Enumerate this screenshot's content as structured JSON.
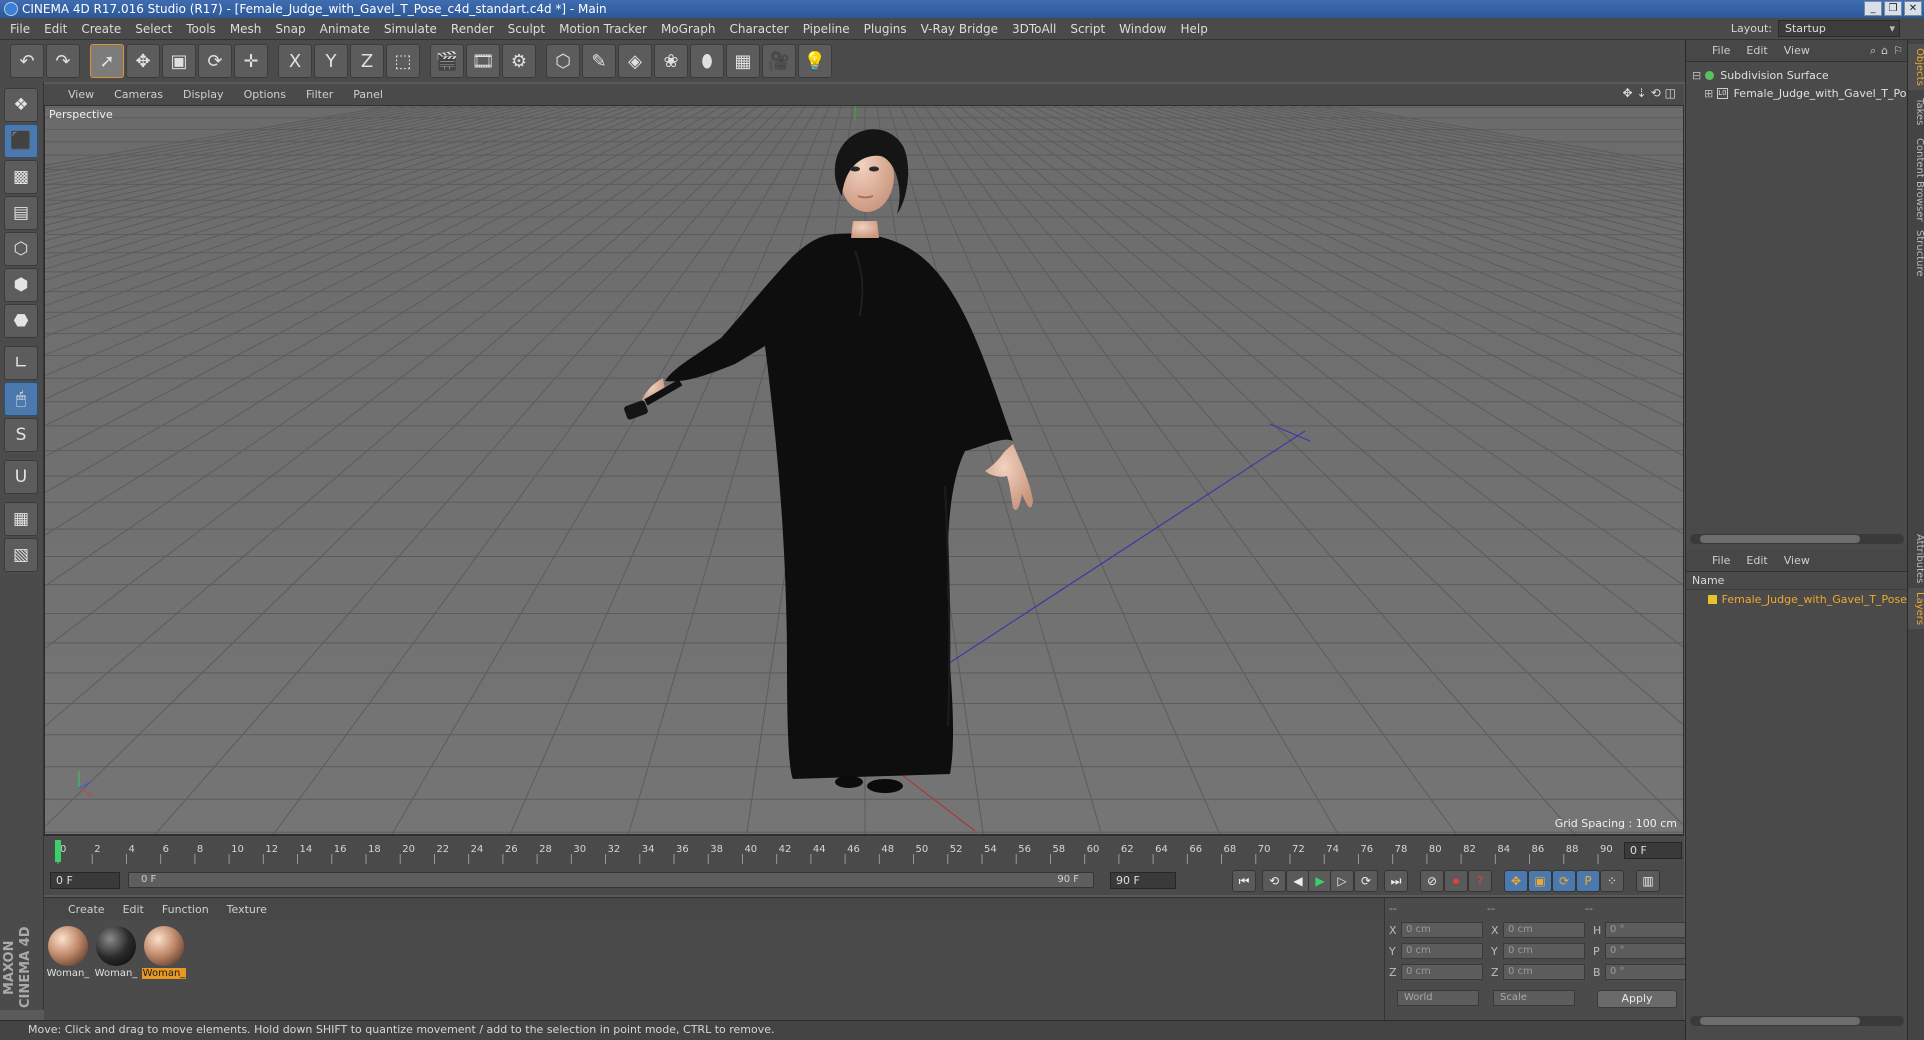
{
  "window": {
    "title": "CINEMA 4D R17.016 Studio (R17) - [Female_Judge_with_Gavel_T_Pose_c4d_standart.c4d *] - Main",
    "buttons": [
      "_",
      "❐",
      "✕"
    ]
  },
  "menu": {
    "items": [
      "File",
      "Edit",
      "Create",
      "Select",
      "Tools",
      "Mesh",
      "Snap",
      "Animate",
      "Simulate",
      "Render",
      "Sculpt",
      "Motion Tracker",
      "MoGraph",
      "Character",
      "Pipeline",
      "Plugins",
      "V-Ray Bridge",
      "3DToAll",
      "Script",
      "Window",
      "Help"
    ],
    "layout_label": "Layout:",
    "layout_value": "Startup"
  },
  "toolbar": {
    "icons": [
      "undo-icon",
      "redo-icon",
      "live-selection-icon",
      "move-icon",
      "scale-icon",
      "rotate-icon",
      "transform-icon",
      "x-axis-icon",
      "y-axis-icon",
      "z-axis-icon",
      "coordinate-system-icon",
      "render-view-icon",
      "render-picture-viewer-icon",
      "edit-render-settings-icon",
      "cube-icon",
      "pen-icon",
      "subdivision-icon",
      "array-icon",
      "deformer-icon",
      "floor-icon",
      "camera-icon",
      "light-icon"
    ],
    "glyphs": [
      "↶",
      "↷",
      "➚",
      "✥",
      "▣",
      "⟳",
      "✛",
      "X",
      "Y",
      "Z",
      "⬚",
      "🎬",
      "🎞",
      "⚙",
      "⬡",
      "✎",
      "◈",
      "❀",
      "⬮",
      "▦",
      "🎥",
      "💡"
    ]
  },
  "lefttools": {
    "icons": [
      "make-editable-icon",
      "model-mode-icon",
      "texture-mode-icon",
      "workplane-icon",
      "points-mode-icon",
      "edges-mode-icon",
      "polygons-mode-icon",
      "axis-mode-icon",
      "tweak-mode-icon",
      "solo-mode-icon",
      "magnet-icon",
      "snap-icon",
      "workplane-lock-icon"
    ],
    "glyphs": [
      "❖",
      "⬛",
      "▩",
      "▤",
      "⬡",
      "⬢",
      "⬣",
      "∟",
      "🖱",
      "S",
      "U",
      "▦",
      "▧"
    ]
  },
  "viewport": {
    "menu": [
      "View",
      "Cameras",
      "Display",
      "Options",
      "Filter",
      "Panel"
    ],
    "label": "Perspective",
    "grid_spacing": "Grid Spacing : 100 cm",
    "nav_glyphs": [
      "✥",
      "⇣",
      "⟲",
      "◫"
    ]
  },
  "timeline": {
    "ticks": [
      "0",
      "2",
      "4",
      "6",
      "8",
      "10",
      "12",
      "14",
      "16",
      "18",
      "20",
      "22",
      "24",
      "26",
      "28",
      "30",
      "32",
      "34",
      "36",
      "38",
      "40",
      "42",
      "44",
      "46",
      "48",
      "50",
      "52",
      "54",
      "56",
      "58",
      "60",
      "62",
      "64",
      "66",
      "68",
      "70",
      "72",
      "74",
      "76",
      "78",
      "80",
      "82",
      "84",
      "86",
      "88",
      "90"
    ],
    "current_frame": "0 F",
    "start_field": "0 F",
    "slider_start": "0 F",
    "slider_end": "90 F",
    "end_field": "90 F",
    "playback_glyphs": [
      "⏮",
      "⟲",
      "◀",
      "▶",
      "▷",
      "⟳",
      "⏭",
      "⊘",
      "⏺",
      "?",
      "✥",
      "▣",
      "⟳",
      "P",
      "⁘",
      "▥"
    ]
  },
  "materials": {
    "menu": [
      "Create",
      "Edit",
      "Function",
      "Texture"
    ],
    "items": [
      {
        "name": "Woman_",
        "selected": false,
        "dark": false
      },
      {
        "name": "Woman_",
        "selected": false,
        "dark": true
      },
      {
        "name": "Woman_",
        "selected": true,
        "dark": false
      }
    ],
    "brand": "MAXON CINEMA 4D"
  },
  "coordinates": {
    "header": [
      "--",
      "--",
      "--"
    ],
    "rows": [
      {
        "a": "X",
        "v1": "0 cm",
        "b": "X",
        "v2": "0 cm",
        "c": "H",
        "v3": "0 °"
      },
      {
        "a": "Y",
        "v1": "0 cm",
        "b": "Y",
        "v2": "0 cm",
        "c": "P",
        "v3": "0 °"
      },
      {
        "a": "Z",
        "v1": "0 cm",
        "b": "Z",
        "v2": "0 cm",
        "c": "B",
        "v3": "0 °"
      }
    ],
    "mode1": "World",
    "mode2": "Scale",
    "apply": "Apply"
  },
  "status": "Move: Click and drag to move elements. Hold down SHIFT to quantize movement / add to the selection in point mode, CTRL to remove.",
  "objects": {
    "menu": [
      "File",
      "Edit",
      "View"
    ],
    "items": [
      "Subdivision Surface",
      "Female_Judge_with_Gavel_T_Pose"
    ]
  },
  "layers": {
    "menu": [
      "File",
      "Edit",
      "View"
    ],
    "header": "Name",
    "items": [
      "Female_Judge_with_Gavel_T_Pose"
    ]
  },
  "side_tabs": [
    "Objects",
    "Takes",
    "Content Browser",
    "Structure",
    "Attributes",
    "Layers"
  ],
  "colors": {
    "accent": "#e8992c",
    "selection_blue": "#4c79ad",
    "viewport_bg": "#707070"
  }
}
